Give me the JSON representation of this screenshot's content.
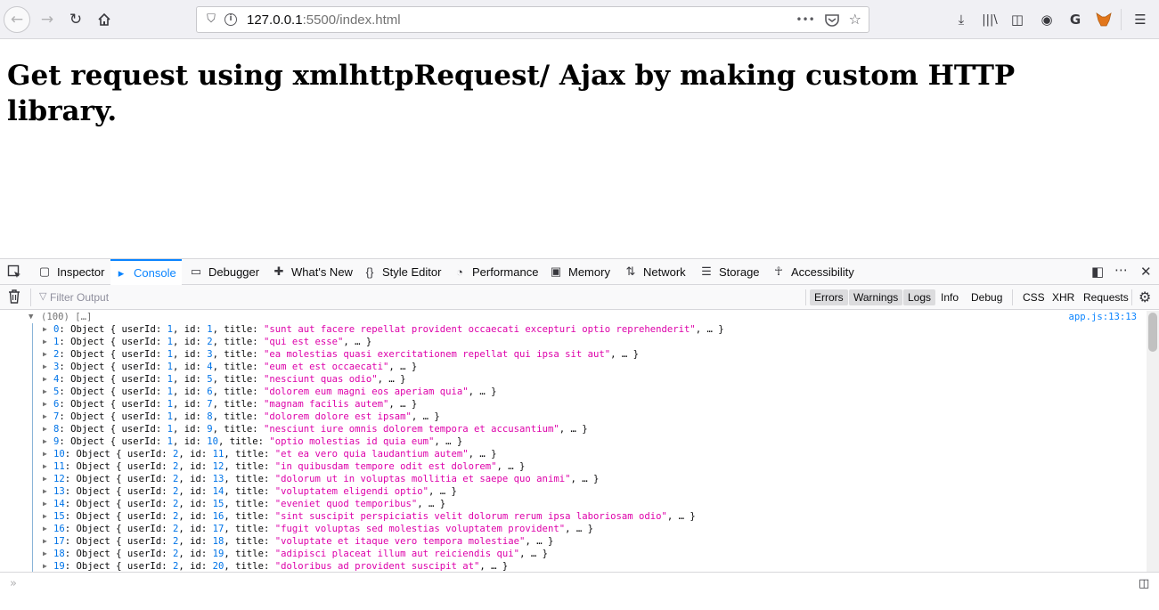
{
  "browser": {
    "url_host": "127.0.0.1",
    "url_rest": ":5500/index.html",
    "page_action_dots": "•••"
  },
  "page": {
    "heading": "Get request using xmlhttpRequest/ Ajax by making custom HTTP library."
  },
  "devtools": {
    "tabs": [
      {
        "label": "Inspector"
      },
      {
        "label": "Console"
      },
      {
        "label": "Debugger"
      },
      {
        "label": "What's New"
      },
      {
        "label": "Style Editor"
      },
      {
        "label": "Performance"
      },
      {
        "label": "Memory"
      },
      {
        "label": "Network"
      },
      {
        "label": "Storage"
      },
      {
        "label": "Accessibility"
      }
    ],
    "active_tab": "Console",
    "filter_placeholder": "Filter Output",
    "filter_buttons": [
      "Errors",
      "Warnings",
      "Logs",
      "Info",
      "Debug",
      "CSS",
      "XHR",
      "Requests"
    ],
    "console": {
      "array_summary": "(100) […]",
      "source": "app.js:13:13",
      "rows": [
        {
          "index": "0",
          "userId": "1",
          "id": "1",
          "title": "\"sunt aut facere repellat provident occaecati excepturi optio reprehenderit\""
        },
        {
          "index": "1",
          "userId": "1",
          "id": "2",
          "title": "\"qui est esse\""
        },
        {
          "index": "2",
          "userId": "1",
          "id": "3",
          "title": "\"ea molestias quasi exercitationem repellat qui ipsa sit aut\""
        },
        {
          "index": "3",
          "userId": "1",
          "id": "4",
          "title": "\"eum et est occaecati\""
        },
        {
          "index": "4",
          "userId": "1",
          "id": "5",
          "title": "\"nesciunt quas odio\""
        },
        {
          "index": "5",
          "userId": "1",
          "id": "6",
          "title": "\"dolorem eum magni eos aperiam quia\""
        },
        {
          "index": "6",
          "userId": "1",
          "id": "7",
          "title": "\"magnam facilis autem\""
        },
        {
          "index": "7",
          "userId": "1",
          "id": "8",
          "title": "\"dolorem dolore est ipsam\""
        },
        {
          "index": "8",
          "userId": "1",
          "id": "9",
          "title": "\"nesciunt iure omnis dolorem tempora et accusantium\""
        },
        {
          "index": "9",
          "userId": "1",
          "id": "10",
          "title": "\"optio molestias id quia eum\""
        },
        {
          "index": "10",
          "userId": "2",
          "id": "11",
          "title": "\"et ea vero quia laudantium autem\""
        },
        {
          "index": "11",
          "userId": "2",
          "id": "12",
          "title": "\"in quibusdam tempore odit est dolorem\""
        },
        {
          "index": "12",
          "userId": "2",
          "id": "13",
          "title": "\"dolorum ut in voluptas mollitia et saepe quo animi\""
        },
        {
          "index": "13",
          "userId": "2",
          "id": "14",
          "title": "\"voluptatem eligendi optio\""
        },
        {
          "index": "14",
          "userId": "2",
          "id": "15",
          "title": "\"eveniet quod temporibus\""
        },
        {
          "index": "15",
          "userId": "2",
          "id": "16",
          "title": "\"sint suscipit perspiciatis velit dolorum rerum ipsa laboriosam odio\""
        },
        {
          "index": "16",
          "userId": "2",
          "id": "17",
          "title": "\"fugit voluptas sed molestias voluptatem provident\""
        },
        {
          "index": "17",
          "userId": "2",
          "id": "18",
          "title": "\"voluptate et itaque vero tempora molestiae\""
        },
        {
          "index": "18",
          "userId": "2",
          "id": "19",
          "title": "\"adipisci placeat illum aut reiciendis qui\""
        },
        {
          "index": "19",
          "userId": "2",
          "id": "20",
          "title": "\"doloribus ad provident suscipit at\""
        }
      ]
    },
    "prompt_symbol": "»"
  },
  "colors": {
    "accent": "#0a84ff",
    "console_key": "#0074e8",
    "console_string": "#dd00a9"
  }
}
